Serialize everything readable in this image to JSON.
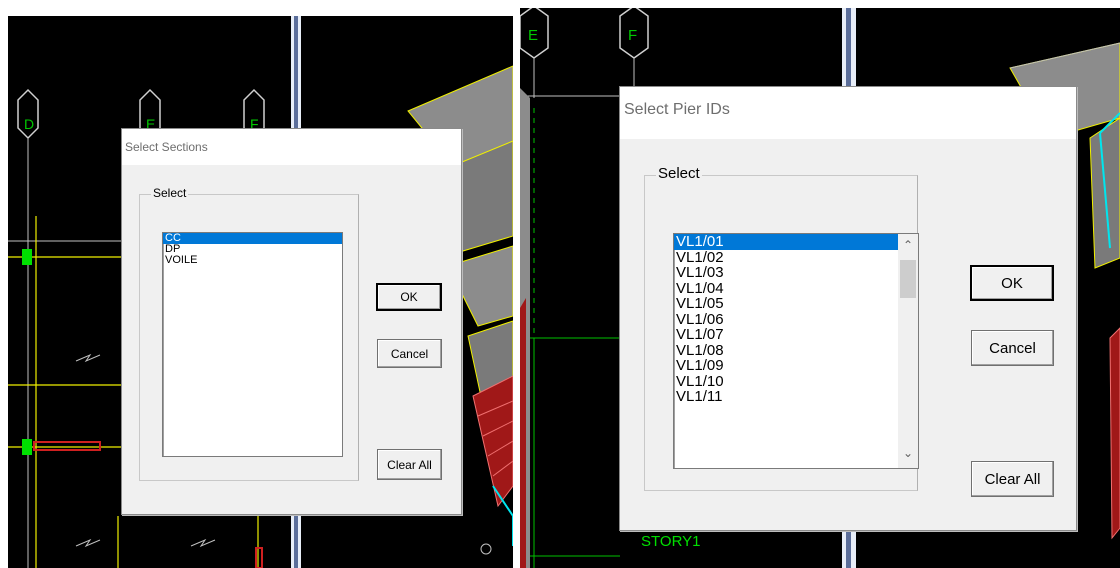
{
  "left_window": {
    "grid_labels": [
      "D",
      "E",
      "F"
    ],
    "dialog": {
      "title": "Select Sections",
      "group_label": "Select",
      "items": [
        "CC",
        "DP",
        "VOILE"
      ],
      "selected_index": 0,
      "buttons": {
        "ok": "OK",
        "cancel": "Cancel",
        "clear_all": "Clear All"
      }
    }
  },
  "right_window": {
    "grid_labels": [
      "E",
      "F"
    ],
    "story_label": "STORY1",
    "dialog": {
      "title": "Select Pier IDs",
      "group_label": "Select",
      "items": [
        "VL1/01",
        "VL1/02",
        "VL1/03",
        "VL1/04",
        "VL1/05",
        "VL1/06",
        "VL1/07",
        "VL1/08",
        "VL1/09",
        "VL1/10",
        "VL1/11"
      ],
      "selected_index": 0,
      "buttons": {
        "ok": "OK",
        "cancel": "Cancel",
        "clear_all": "Clear All"
      }
    }
  },
  "colors": {
    "canvas_bg": "#000000",
    "grid_bubble": "#00c800",
    "grid_line": "#f0f000",
    "selection": "#0078d7",
    "model_gray": "#8c8c8c",
    "model_red": "#b22222",
    "model_cyan": "#00e5ee"
  }
}
